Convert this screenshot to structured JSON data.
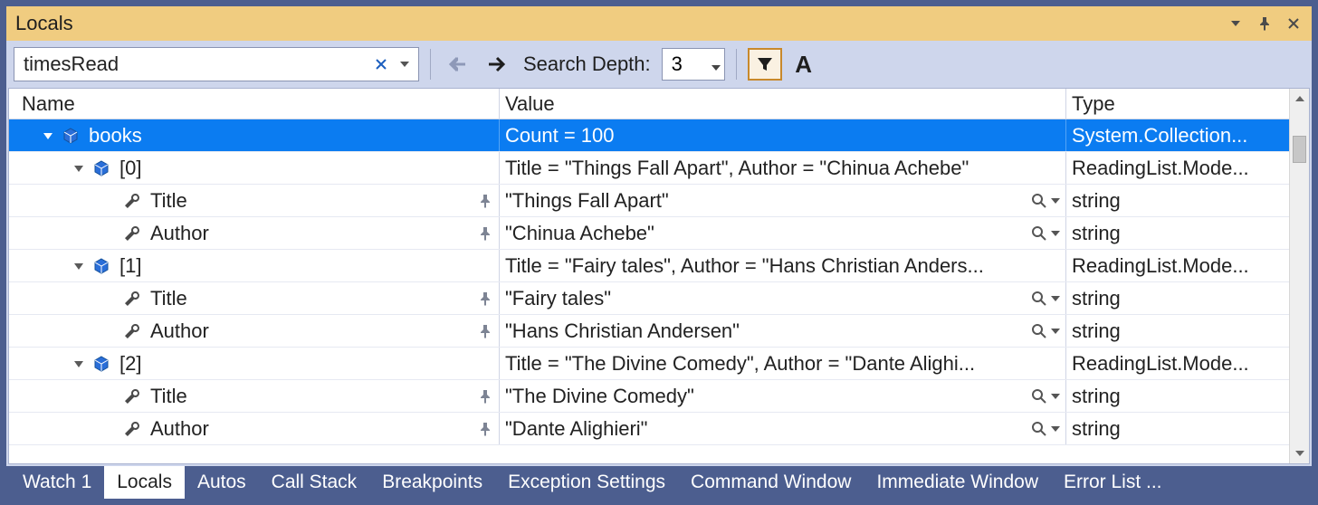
{
  "window": {
    "title": "Locals"
  },
  "toolbar": {
    "search_value": "timesRead",
    "depth_label": "Search Depth:",
    "depth_value": "3"
  },
  "columns": {
    "name": "Name",
    "value": "Value",
    "type": "Type"
  },
  "rows": [
    {
      "depth": 0,
      "expandable": true,
      "expanded": true,
      "selected": true,
      "icon": "cube",
      "name": "books",
      "value": "Count = 100",
      "type": "System.Collection...",
      "pin": false,
      "mag": false
    },
    {
      "depth": 1,
      "expandable": true,
      "expanded": true,
      "selected": false,
      "icon": "cube",
      "name": "[0]",
      "value": "Title = \"Things Fall Apart\", Author = \"Chinua Achebe\"",
      "type": "ReadingList.Mode...",
      "pin": false,
      "mag": false
    },
    {
      "depth": 2,
      "expandable": false,
      "expanded": false,
      "selected": false,
      "icon": "wrench",
      "name": "Title",
      "value": "\"Things Fall Apart\"",
      "type": "string",
      "pin": true,
      "mag": true
    },
    {
      "depth": 2,
      "expandable": false,
      "expanded": false,
      "selected": false,
      "icon": "wrench",
      "name": "Author",
      "value": "\"Chinua Achebe\"",
      "type": "string",
      "pin": true,
      "mag": true
    },
    {
      "depth": 1,
      "expandable": true,
      "expanded": true,
      "selected": false,
      "icon": "cube",
      "name": "[1]",
      "value": "Title = \"Fairy tales\", Author = \"Hans Christian Anders...",
      "type": "ReadingList.Mode...",
      "pin": false,
      "mag": false
    },
    {
      "depth": 2,
      "expandable": false,
      "expanded": false,
      "selected": false,
      "icon": "wrench",
      "name": "Title",
      "value": "\"Fairy tales\"",
      "type": "string",
      "pin": true,
      "mag": true
    },
    {
      "depth": 2,
      "expandable": false,
      "expanded": false,
      "selected": false,
      "icon": "wrench",
      "name": "Author",
      "value": "\"Hans Christian Andersen\"",
      "type": "string",
      "pin": true,
      "mag": true
    },
    {
      "depth": 1,
      "expandable": true,
      "expanded": true,
      "selected": false,
      "icon": "cube",
      "name": "[2]",
      "value": "Title = \"The Divine Comedy\", Author = \"Dante Alighi...",
      "type": "ReadingList.Mode...",
      "pin": false,
      "mag": false
    },
    {
      "depth": 2,
      "expandable": false,
      "expanded": false,
      "selected": false,
      "icon": "wrench",
      "name": "Title",
      "value": "\"The Divine Comedy\"",
      "type": "string",
      "pin": true,
      "mag": true
    },
    {
      "depth": 2,
      "expandable": false,
      "expanded": false,
      "selected": false,
      "icon": "wrench",
      "name": "Author",
      "value": "\"Dante Alighieri\"",
      "type": "string",
      "pin": true,
      "mag": true
    }
  ],
  "tabs": [
    {
      "label": "Watch 1",
      "active": false
    },
    {
      "label": "Locals",
      "active": true
    },
    {
      "label": "Autos",
      "active": false
    },
    {
      "label": "Call Stack",
      "active": false
    },
    {
      "label": "Breakpoints",
      "active": false
    },
    {
      "label": "Exception Settings",
      "active": false
    },
    {
      "label": "Command Window",
      "active": false
    },
    {
      "label": "Immediate Window",
      "active": false
    },
    {
      "label": "Error List ...",
      "active": false
    }
  ]
}
